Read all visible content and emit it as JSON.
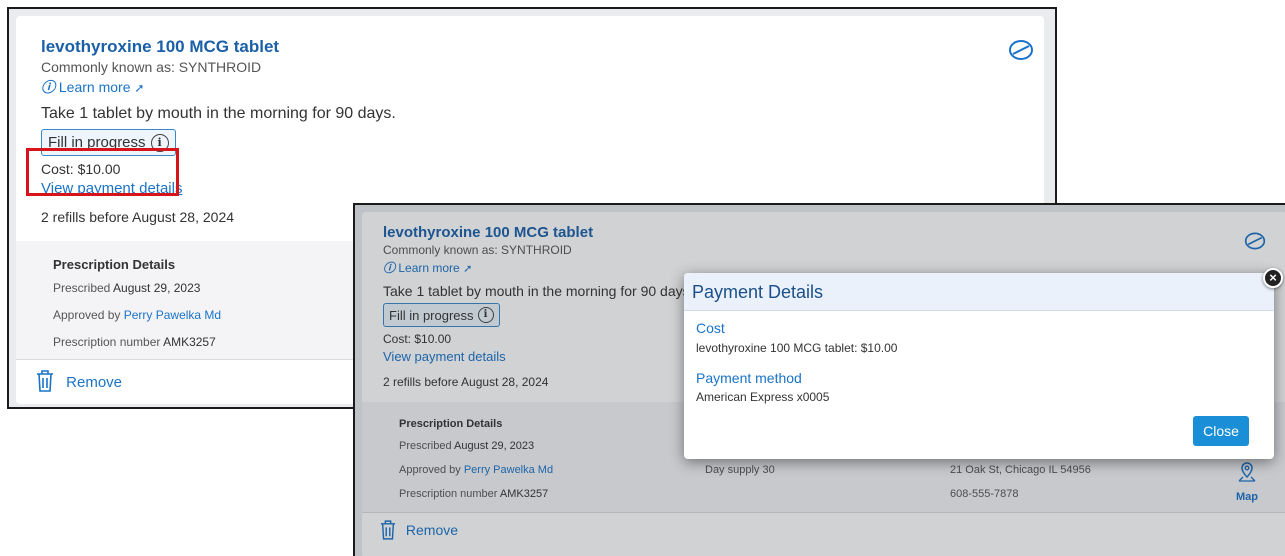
{
  "panel1": {
    "drug_name": "levothyroxine 100 MCG tablet",
    "common_name": "Commonly known as: SYNTHROID",
    "learn_more": "Learn more",
    "instructions": "Take 1 tablet by mouth in the morning for 90 days.",
    "status_badge": "Fill in progress",
    "cost": "Cost: $10.00",
    "view_payment": "View payment details",
    "refills": "2 refills before August 28, 2024",
    "details": {
      "heading": "Prescription Details",
      "prescribed_label": "Prescribed",
      "prescribed_date": "August 29, 2023",
      "approved_label": "Approved by",
      "approved_name": "Perry Pawelka Md",
      "rx_label": "Prescription number",
      "rx_number": "AMK3257"
    },
    "remove": "Remove"
  },
  "panel2": {
    "drug_name": "levothyroxine 100 MCG tablet",
    "common_name": "Commonly known as: SYNTHROID",
    "learn_more": "Learn more",
    "instructions": "Take 1 tablet by mouth in the morning for 90 days.",
    "status_badge": "Fill in progress",
    "cost": "Cost: $10.00",
    "view_payment": "View payment details",
    "refills": "2 refills before August 28, 2024",
    "details": {
      "heading": "Prescription Details",
      "prescribed_label": "Prescribed",
      "prescribed_date": "August 29, 2023",
      "approved_label": "Approved by",
      "approved_name": "Perry Pawelka Md",
      "rx_label": "Prescription number",
      "rx_number": "AMK3257",
      "day_supply": "Day supply 30",
      "address": "21 Oak St, Chicago IL 54956",
      "phone": "608-555-7878",
      "map": "Map"
    },
    "remove": "Remove"
  },
  "modal": {
    "title": "Payment Details",
    "cost_heading": "Cost",
    "cost_line": "levothyroxine 100 MCG tablet: $10.00",
    "method_heading": "Payment method",
    "method_line": "American Express x0005",
    "close_label": "Close",
    "close_x": "×"
  },
  "icons": {
    "pill": "pill-icon",
    "info": "info-icon",
    "external": "external-link-icon",
    "trash": "trash-icon",
    "map_pin": "map-pin-icon"
  },
  "colors": {
    "link": "#1a73c8",
    "title": "#1a5fa8",
    "highlight": "#d7141a",
    "close_button": "#1a8fd8"
  }
}
